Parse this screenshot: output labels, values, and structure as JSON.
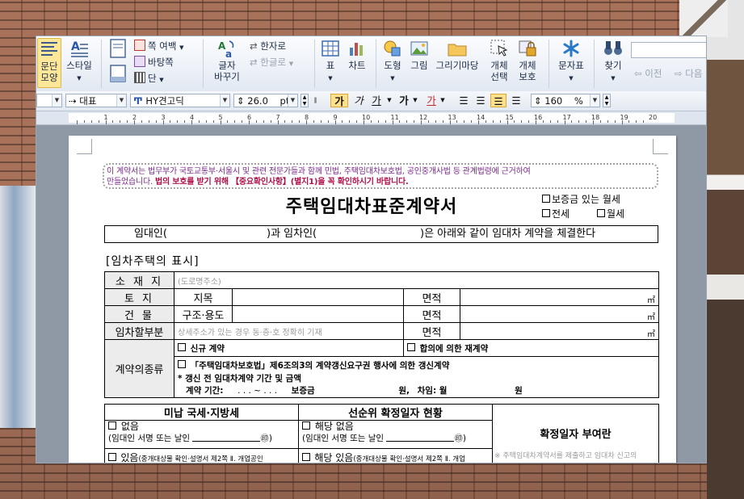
{
  "ribbon": {
    "paragraph_shape": "문단\n모양",
    "style": "스타일",
    "page_margin": "쪽 여백",
    "background": "바탕쪽",
    "column": "단",
    "char_convert": "글자\n바꾸기",
    "hanja": "한자로",
    "hangul": "한글로",
    "table": "표",
    "chart": "차트",
    "shape": "도형",
    "picture": "그림",
    "drawing_wizard": "그리기마당",
    "object_select": "개체\n선택",
    "object_protect": "개체\n보호",
    "char_map": "문자표",
    "find": "찾기",
    "prev": "이전",
    "next": "다음"
  },
  "format_bar": {
    "style_value": "대표",
    "font_value": "HY견고딕",
    "size_value": "26.0",
    "size_unit": "pt",
    "bold": "가",
    "italic": "가",
    "underline": "가",
    "strike": "가",
    "color": "가",
    "line_spacing": "160",
    "line_unit": "%"
  },
  "ruler": {
    "numbers": [
      "1",
      "2",
      "3",
      "4",
      "5",
      "6",
      "7",
      "8",
      "9",
      "10",
      "11",
      "12",
      "13",
      "14",
      "15",
      "16",
      "17",
      "18",
      "19",
      "20"
    ]
  },
  "document": {
    "notice_line1": "이 계약서는 법무부가 국토교통부·서울시 및 관련 전문가들과 함께 민법, 주택임대차보호법, 공인중개사법 등 관계법령에 근거하여",
    "notice_line2a": "만들었습니다.",
    "notice_line2b": "법의 보호를 받기 위해 【중요확인사항】(별지1)을 꼭 확인하시기 바랍니다.",
    "title": "주택임대차표준계약서",
    "check_deposit_monthly": "보증금 있는 월세",
    "check_jeonse": "전세",
    "check_monthly": "월세",
    "party_a": "임대인(",
    "party_b": ")과 임차인(",
    "party_c": ")은 아래와 같이 임대차 계약을 체결한다",
    "section_title": "[임차주택의 표시]",
    "row_location": "소 재 지",
    "row_location_hint": "(도로명주소)",
    "row_land": "토    지",
    "row_land_sub": "지목",
    "row_area": "면적",
    "unit_m2": "㎡",
    "row_building": "건    물",
    "row_building_sub": "구조·용도",
    "row_part": "임차할부분",
    "row_part_hint": "상세주소가 있는 경우 동·층·호 정확히 기재",
    "row_contract_type": "계약의종류",
    "type_new": "신규 계약",
    "type_agree": "합의에 의한 재계약",
    "type_renew": "「주택임대차보호법」제6조의3의 계약갱신요구권 행사에 의한 갱신계약",
    "renew_note": "* 갱신 전 임대차계약 기간 및 금액",
    "renew_period": "계약 기간:",
    "renew_dots": ".      .      .   ~      .      .      .",
    "renew_deposit": "보증금",
    "renew_won": "원,",
    "renew_rent": "차임: 월",
    "renew_won2": "원",
    "tax_header": "미납 국세·지방세",
    "priority_header": "선순위 확정일자 현황",
    "fixed_date": "확정일자 부여란",
    "none": "없음",
    "sign_note": "(임대인 서명 또는 날인",
    "seal": "㊞)",
    "none2": "해당 없음",
    "exists": "있음",
    "exists_note": "(중개대상물 확인·설명서 제2쪽 Ⅱ. 개업공인",
    "exists2": "해당 있음",
    "exists2_note": "(중개대상물 확인·설명서 제2쪽 Ⅱ. 개업",
    "fixed_note": "※ 주택임대차계약서를 제출하고 임대차 신고의"
  }
}
